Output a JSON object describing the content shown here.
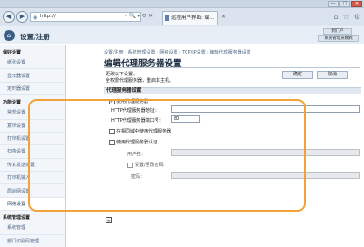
{
  "browser": {
    "minimize": "—",
    "maximize": "□",
    "close": "✕",
    "back": "◀",
    "forward": "▶",
    "url": "http://",
    "url_controls": "▾ 🔍 ▾ ⟳ ✕",
    "tab_title": "远程用户界面: 编...",
    "tab_close": "✕",
    "tool_icons": [
      "home-icon",
      "star-icon",
      "gear-icon"
    ]
  },
  "app": {
    "title": "设置/注册",
    "header_btn1": "到门户",
    "header_btn2": "系统管理员模式"
  },
  "sidebar": {
    "sections": [
      {
        "title": "偏好设置",
        "items": [
          "纸张设置",
          "显示器设置",
          "定时器设置"
        ]
      },
      {
        "title": "功能设置",
        "items": [
          "常规设置",
          "复印设置",
          "打印机设置",
          "扫描设置",
          "传真发送设置",
          "打印机输入",
          "局域网设置",
          "网络设置"
        ]
      },
      {
        "title": "系统管理设置",
        "items": [
          "系统管理",
          "部门识别码管理"
        ]
      }
    ]
  },
  "main": {
    "breadcrumb": "设置/注册 : 系统管理设置 : 网络设置 : TCP/IP设置 : 编辑代理服务器设置",
    "title": "编辑代理服务器设置",
    "note1": "更改以下设置。",
    "note2": "全权限代理服务器，重启本主机。",
    "ok": "确定",
    "cancel": "取消",
    "section_title": "代理服务器设置",
    "use_proxy_label": "使用代理服务器",
    "use_proxy_checked": true,
    "http_addr_label": "HTTP代理服务器地址：",
    "http_addr_value": "",
    "http_port_label": "HTTP代理服务器端口号：",
    "http_port_value": "80",
    "same_domain_label": "在相同域中使用代理服务器",
    "auth_label": "使用代理服务器认证",
    "username_label": "用户名：",
    "set_password_label": "设置/更改密码",
    "password_label": "密码："
  }
}
